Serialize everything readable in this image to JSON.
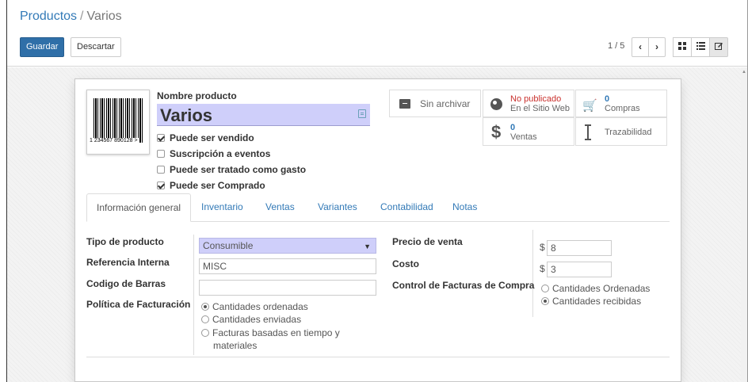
{
  "breadcrumb": {
    "parent": "Productos",
    "separator": "/",
    "current": "Varios"
  },
  "toolbar": {
    "save_label": "Guardar",
    "discard_label": "Descartar"
  },
  "pager": {
    "value": "1 / 5",
    "prev_icon": "chevron-left-icon",
    "next_icon": "chevron-right-icon"
  },
  "views": {
    "kanban_icon": "kanban-view-icon",
    "list_icon": "list-view-icon",
    "form_icon": "form-view-icon"
  },
  "product": {
    "barcode_digits": "1 234567 890128 >",
    "name_label": "Nombre producto",
    "name": "Varios",
    "checkboxes": [
      {
        "label": "Puede ser vendido",
        "checked": true
      },
      {
        "label": "Suscripción a eventos",
        "checked": false
      },
      {
        "label": "Puede ser tratado como gasto",
        "checked": false
      },
      {
        "label": "Puede ser Comprado",
        "checked": true
      }
    ]
  },
  "smart_buttons": {
    "archive": "Sin archivar",
    "website_status": "No publicado",
    "website_label": "En el Sitio Web",
    "purchases_count": "0",
    "purchases_label": "Compras",
    "sales_count": "0",
    "sales_label": "Ventas",
    "traceability": "Trazabilidad"
  },
  "tabs": [
    "Información general",
    "Inventario",
    "Ventas",
    "Variantes",
    "Contabilidad",
    "Notas"
  ],
  "general": {
    "type_label": "Tipo de producto",
    "type_value": "Consumible",
    "ref_label": "Referencia Interna",
    "ref_value": "MISC",
    "barcode_label": "Codigo de Barras",
    "barcode_value": "",
    "policy_label": "Política de Facturación",
    "policy_options": [
      "Cantidades ordenadas",
      "Cantidades enviadas",
      "Facturas basadas en tiempo y",
      "materiales"
    ],
    "sale_price_label": "Precio de venta",
    "sale_price": "8",
    "cost_label": "Costo",
    "cost": "3",
    "currency": "$",
    "purchase_control_label": "Control de Facturas de Compra",
    "purchase_control_options": [
      "Cantidades Ordenadas",
      "Cantidades recibidas"
    ]
  },
  "colors": {
    "primary": "#2f6fa8",
    "link": "#337ab7",
    "required_field": "#cfcffa",
    "unpublished": "#c9302c"
  }
}
